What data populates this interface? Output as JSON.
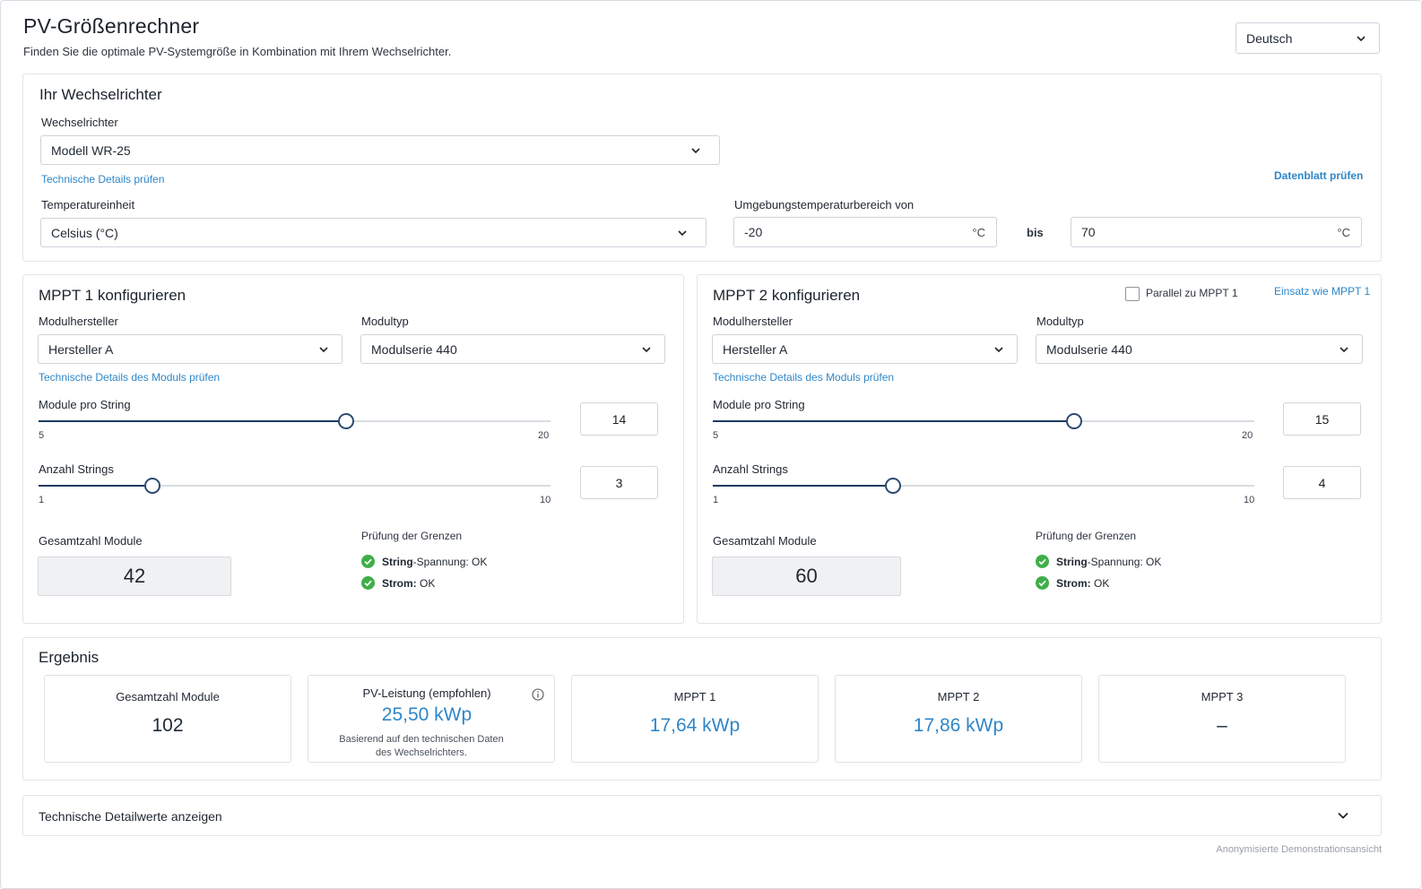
{
  "header": {
    "title": "PV-Größenrechner",
    "subtitle": "Finden Sie die optimale PV-Systemgröße in Kombination mit Ihrem Wechselrichter.",
    "language": "Deutsch"
  },
  "inverter": {
    "section_title": "Ihr Wechselrichter",
    "inverter_label": "Wechselrichter",
    "inverter_value": "Modell WR-25",
    "tech_details_link": "Technische Details prüfen",
    "datasheet_link": "Datenblatt prüfen",
    "temp_unit_label": "Temperatureinheit",
    "temp_unit_value": "Celsius (°C)",
    "ambient_label": "Umgebungstemperaturbereich von",
    "temp_from": "-20",
    "temp_to": "70",
    "unit": "°C",
    "bis": "bis"
  },
  "mppt1": {
    "title": "MPPT 1 konfigurieren",
    "manufacturer_label": "Modulhersteller",
    "manufacturer_value": "Hersteller A",
    "type_label": "Modultyp",
    "type_value": "Modulserie 440",
    "module_details_link": "Technische Details des Moduls prüfen",
    "modules_per_string_label": "Module pro String",
    "modules_per_string": {
      "min": "5",
      "max": "20",
      "value": "14",
      "fraction": 0.6
    },
    "strings_label": "Anzahl Strings",
    "strings": {
      "min": "1",
      "max": "10",
      "value": "3",
      "fraction": 0.2222
    },
    "total_label": "Gesamtzahl Module",
    "total_value": "42",
    "limits_label": "Prüfung der Grenzen",
    "check_voltage_bold": "String",
    "check_voltage_rest": "-Spannung: OK",
    "check_current_bold": "Strom:",
    "check_current_rest": " OK"
  },
  "mppt2": {
    "title": "MPPT 2 konfigurieren",
    "parallel_label": "Parallel zu MPPT 1",
    "parallel_checked": false,
    "use_as_link": "Einsatz wie MPPT 1",
    "manufacturer_label": "Modulhersteller",
    "manufacturer_value": "Hersteller A",
    "type_label": "Modultyp",
    "type_value": "Modulserie 440",
    "module_details_link": "Technische Details des Moduls prüfen",
    "modules_per_string_label": "Module pro String",
    "modules_per_string": {
      "min": "5",
      "max": "20",
      "value": "15",
      "fraction": 0.6667
    },
    "strings_label": "Anzahl Strings",
    "strings": {
      "min": "1",
      "max": "10",
      "value": "4",
      "fraction": 0.3333
    },
    "total_label": "Gesamtzahl Module",
    "total_value": "60",
    "limits_label": "Prüfung der Grenzen",
    "check_voltage_bold": "String",
    "check_voltage_rest": "-Spannung: OK",
    "check_current_bold": "Strom:",
    "check_current_rest": " OK"
  },
  "result": {
    "title": "Ergebnis",
    "cards": [
      {
        "label": "Gesamtzahl Module",
        "value": "102"
      },
      {
        "label": "PV-Leistung (empfohlen)",
        "value": "25,50 kWp",
        "note_line1": "Basierend auf den technischen Daten",
        "note_line2": "des Wechselrichters."
      },
      {
        "label": "MPPT 1",
        "value": "17,64 kWp"
      },
      {
        "label": "MPPT 2",
        "value": "17,86 kWp"
      },
      {
        "label": "MPPT 3",
        "value": "–"
      }
    ]
  },
  "details": {
    "label": "Technische Detailwerte anzeigen"
  },
  "footer": {
    "note": "Anonymisierte Demonstrationsansicht"
  },
  "colors": {
    "accent": "#2f86c8",
    "slider": "#1d3a5f",
    "ok": "#3fae49"
  }
}
